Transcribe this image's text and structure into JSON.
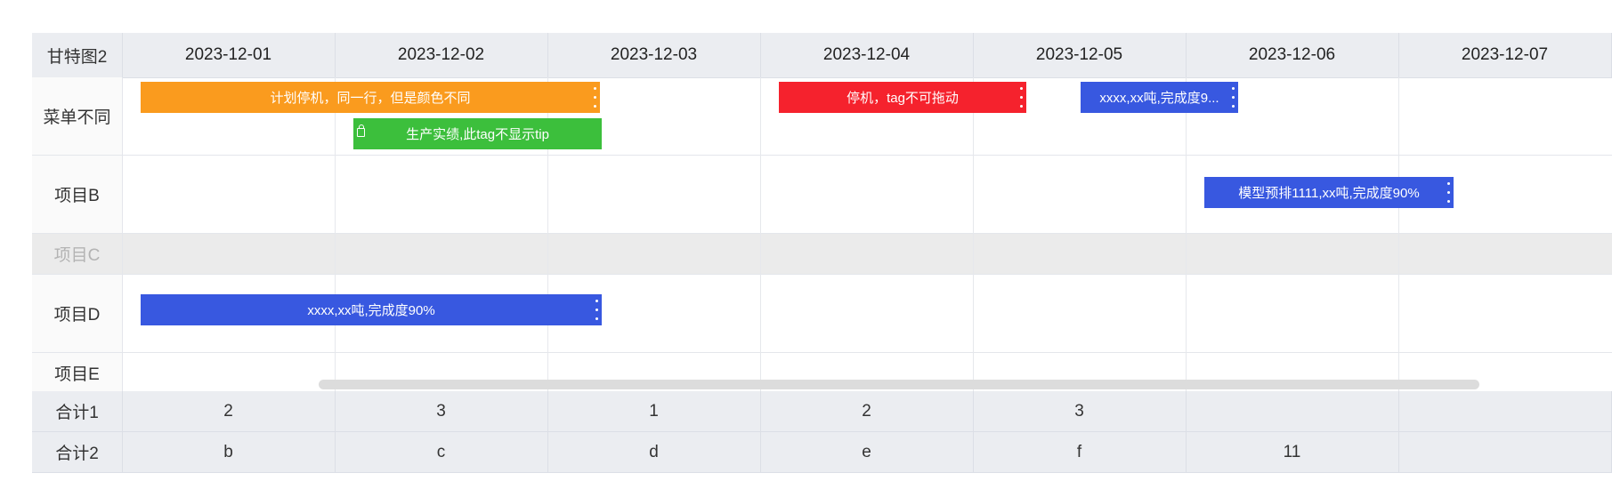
{
  "gantt": {
    "title": "甘特图2",
    "dates": [
      "2023-12-01",
      "2023-12-02",
      "2023-12-03",
      "2023-12-04",
      "2023-12-05",
      "2023-12-06",
      "2023-12-07"
    ],
    "rows": [
      {
        "label": "菜单不同"
      },
      {
        "label": "项目B"
      },
      {
        "label": "项目C",
        "disabled": true
      },
      {
        "label": "项目D"
      },
      {
        "label": "项目E"
      }
    ],
    "bars": [
      {
        "text": "计划停机，同一行，但是颜色不同",
        "color": "#fa9b1e",
        "has_menu": true
      },
      {
        "text": "生产实绩,此tag不显示tip",
        "color": "#3cbf3c",
        "icon": "bag-icon"
      },
      {
        "text": "停机，tag不可拖动",
        "color": "#f5222d",
        "has_menu": true
      },
      {
        "text": "xxxx,xx吨,完成度9...",
        "color": "#3858e0",
        "has_menu": true
      },
      {
        "text": "模型预排1111,xx吨,完成度90%",
        "color": "#3858e0",
        "has_menu": true
      },
      {
        "text": "xxxx,xx吨,完成度90%",
        "color": "#3858e0",
        "has_menu": true
      }
    ],
    "summary": [
      {
        "label": "合计1",
        "values": [
          "2",
          "3",
          "1",
          "2",
          "3",
          "",
          ""
        ]
      },
      {
        "label": "合计2",
        "values": [
          "b",
          "c",
          "d",
          "e",
          "f",
          "11",
          ""
        ]
      }
    ]
  }
}
